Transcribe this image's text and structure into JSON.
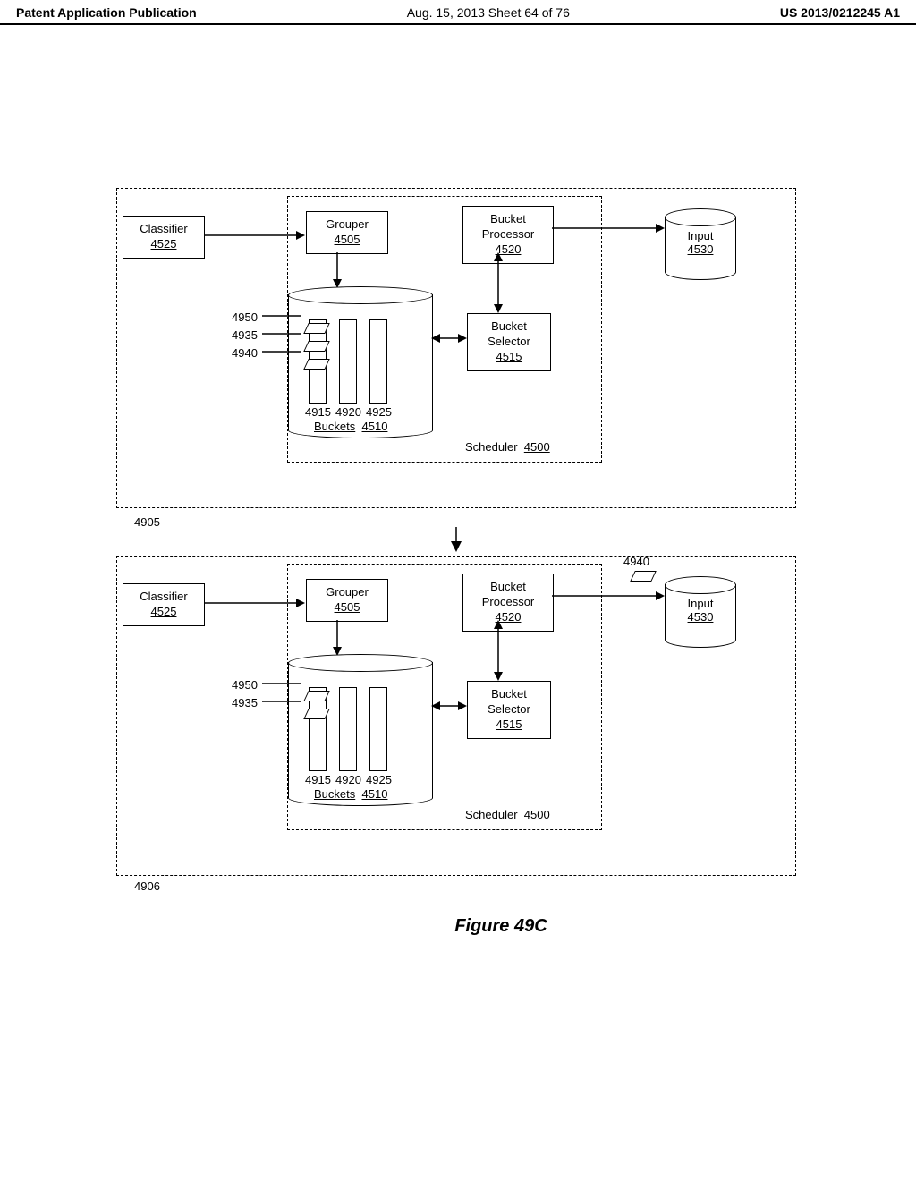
{
  "header": {
    "left": "Patent Application Publication",
    "center": "Aug. 15, 2013  Sheet 64 of 76",
    "right": "US 2013/0212245 A1"
  },
  "blocks": {
    "classifier": {
      "name": "Classifier",
      "id": "4525"
    },
    "grouper": {
      "name": "Grouper",
      "id": "4505"
    },
    "bucketProcessor": {
      "name": "Bucket Processor",
      "id": "4520"
    },
    "bucketSelector": {
      "name": "Bucket Selector",
      "id": "4515"
    },
    "input": {
      "name": "Input",
      "id": "4530"
    },
    "buckets": {
      "name": "Buckets",
      "id": "4510"
    },
    "scheduler": {
      "name": "Scheduler",
      "id": "4500"
    }
  },
  "refs": {
    "stageTop": "4905",
    "stageBottom": "4906",
    "item4950": "4950",
    "item4935": "4935",
    "item4940": "4940",
    "slot1": "4915",
    "slot2": "4920",
    "slot3": "4925"
  },
  "figcap": "Figure 49C"
}
